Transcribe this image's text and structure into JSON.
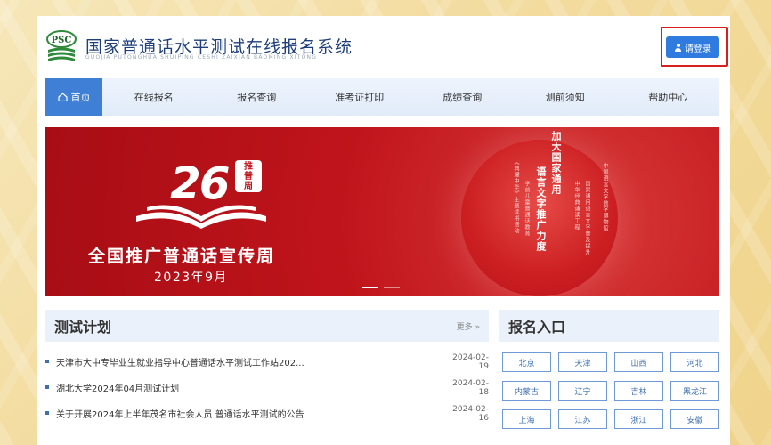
{
  "header": {
    "logo_text": "PSC",
    "title": "国家普通话水平测试在线报名系统",
    "subtitle": "GUOJIA PUTONGHUA SHUIPING CESHI ZAIXIAN BAOMING XITONG",
    "login_label": "请登录"
  },
  "nav": {
    "items": [
      "首页",
      "在线报名",
      "报名查询",
      "准考证打印",
      "成绩查询",
      "测前须知",
      "帮助中心"
    ]
  },
  "banner": {
    "number": "26",
    "seal": [
      "推",
      "普",
      "周"
    ],
    "title": "全国推广普通话宣传周",
    "date": "2023年9月",
    "main_vertical": [
      "加大国家通用",
      "语言文字推广力度"
    ],
    "side_verticals": [
      "中华经典诵读工程",
      "国家通用语言文字普及提升",
      "学前儿童普通话教育",
      "《典耀中华》主题读书活动",
      "中国语言文字数字博物馆"
    ]
  },
  "plan": {
    "title": "测试计划",
    "more_label": "更多 »",
    "items": [
      {
        "title": "天津市大中专毕业生就业指导中心普通话水平测试工作站202...",
        "date": "2024-02-19"
      },
      {
        "title": "湖北大学2024年04月测试计划",
        "date": "2024-02-18"
      },
      {
        "title": "关于开展2024年上半年茂名市社会人员 普通话水平测试的公告",
        "date": "2024-02-16"
      }
    ]
  },
  "region": {
    "title": "报名入口",
    "items": [
      "北京",
      "天津",
      "山西",
      "河北",
      "内蒙古",
      "辽宁",
      "吉林",
      "黑龙江",
      "上海",
      "江苏",
      "浙江",
      "安徽"
    ]
  },
  "colors": {
    "accent": "#2f7be0",
    "nav_active": "#3f7fd6",
    "banner_red": "#c0141b",
    "highlight_border": "#d91e1e"
  }
}
